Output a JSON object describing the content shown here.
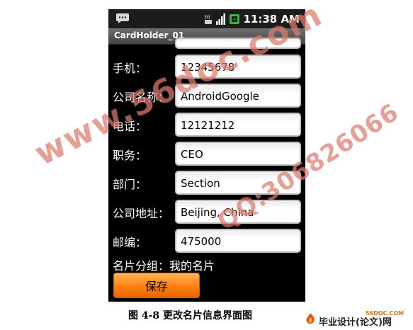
{
  "status_bar": {
    "time": "11:38 AM"
  },
  "app": {
    "title": "CardHolder_01"
  },
  "form": {
    "rows": [
      {
        "label": "手机：",
        "value": "12345678"
      },
      {
        "label": "公司名称：",
        "value": "AndroidGoogle"
      },
      {
        "label": "电话：",
        "value": "12121212"
      },
      {
        "label": "职务：",
        "value": "CEO"
      },
      {
        "label": "部门：",
        "value": "Section"
      },
      {
        "label": "公司地址：",
        "value": "Beijing, China"
      },
      {
        "label": "邮编：",
        "value": "475000"
      }
    ],
    "group_line": "名片分组：我的名片",
    "save_label": "保存"
  },
  "caption": "图 4-8 更改名片信息界面图",
  "watermarks": {
    "primary": "www.56doc.com",
    "secondary": "QQ:306826066"
  },
  "logo": {
    "top": "56DOC.COM",
    "text": "毕业设计(论文)网"
  },
  "colors": {
    "save_button": "#ff7f0f",
    "watermark": "#d2503c"
  }
}
